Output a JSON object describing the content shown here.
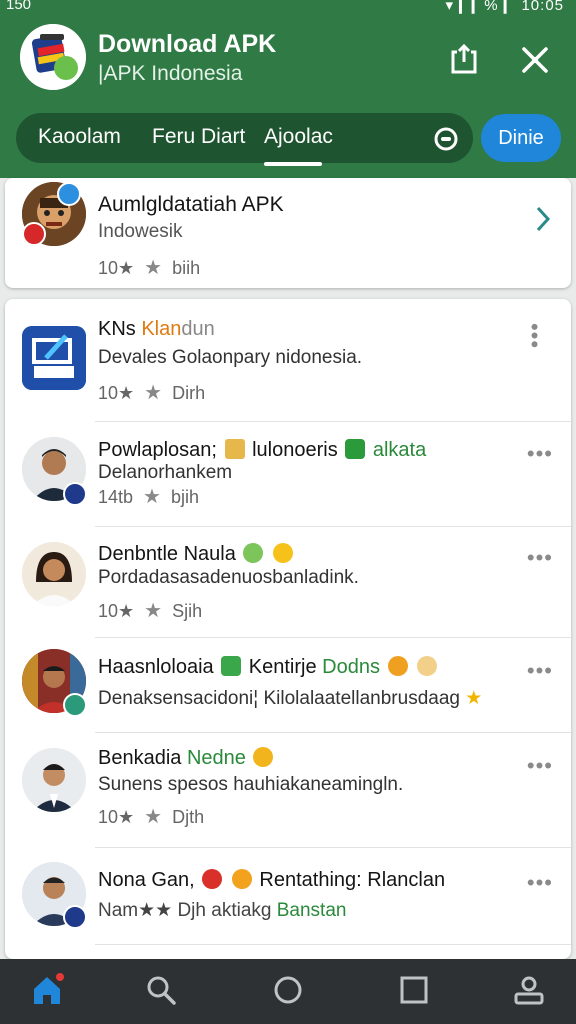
{
  "status": {
    "time": "150",
    "right": "▾ ▎▎% ▎ 10:05"
  },
  "header": {
    "title": "Download APK",
    "subtitle": "|APK Indonesia",
    "tabs": [
      "Kaoolam",
      "Feru Diart",
      "Ajoolac"
    ],
    "active_tab": "Ajoolac",
    "done_label": "Dinie",
    "colors": {
      "header_bg": "#2f7a45",
      "tabbar_bg": "#1e5430",
      "accent": "#1f86d9"
    }
  },
  "featured": {
    "title": "Aumlgldatatiah APK",
    "subtitle": "Indowesik",
    "meta_count": "10★",
    "meta_text": "biih"
  },
  "items": [
    {
      "title_pre": "KNs ",
      "title_accent": "Klan",
      "title_post": "dun",
      "desc": "Devales Golaonpary nidonesia.",
      "meta_count": "10★",
      "meta_text": "Dirh"
    },
    {
      "title": "Powlaplosan;",
      "title_mid": "lulonoeris",
      "title_accent": "alkata",
      "desc": "Delanorhankem",
      "meta_count": "14tb",
      "meta_text": "bjih"
    },
    {
      "title": "Denbntle Naula",
      "desc": "Pordadasasadenuosbanladink.",
      "meta_count": "10★",
      "meta_text": "Sjih"
    },
    {
      "title": "Haasnloloaia",
      "title_mid": "Kentirje",
      "title_accent": "Dodns",
      "desc": "Denaksensacidoni¦ Kilolalaatellanbrusdaag",
      "meta_count": "",
      "meta_text": ""
    },
    {
      "title": "Benkadia",
      "title_accent": "Nedne",
      "desc": "Sunens spesos hauhiakaneamingln.",
      "meta_count": "10★",
      "meta_text": "Djth"
    },
    {
      "title": "Nona Gan,",
      "title_post": "Rentathing: Rlanclan",
      "desc": "Nam★★ Djh aktiakg",
      "desc_accent": "Banstan",
      "meta_count": "",
      "meta_text": ""
    }
  ],
  "more_label": "•••",
  "nav": {
    "items": [
      "home",
      "search",
      "circle",
      "square",
      "profile"
    ]
  }
}
